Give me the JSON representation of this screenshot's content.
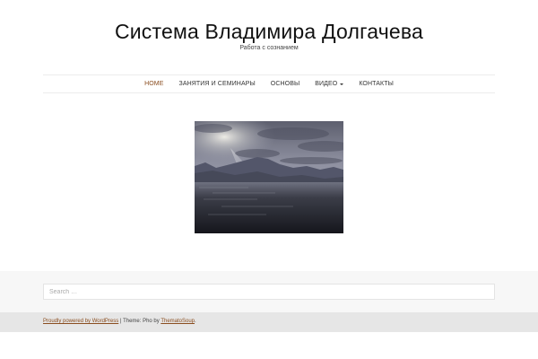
{
  "header": {
    "site_title": "Система Владимира Долгачева",
    "site_description": "Работа с сознанием"
  },
  "nav": {
    "items": [
      {
        "label": "HOME",
        "current": true
      },
      {
        "label": "ЗАНЯТИЯ И СЕМИНАРЫ"
      },
      {
        "label": "ОСНОВЫ"
      },
      {
        "label": "ВИДЕО",
        "has_submenu": true
      },
      {
        "label": "КОНТАКТЫ"
      }
    ]
  },
  "footer": {
    "search_placeholder": "Search …",
    "powered_link": "Proudly powered by WordPress",
    "separator": " | ",
    "theme_text": "Theme: Pho by ",
    "theme_author_link": "ThematoSoup",
    "period": "."
  },
  "colors": {
    "accent": "#8a4d1f",
    "footer_widget_bg": "#f7f7f7",
    "site_info_bg": "#e6e6e6"
  }
}
